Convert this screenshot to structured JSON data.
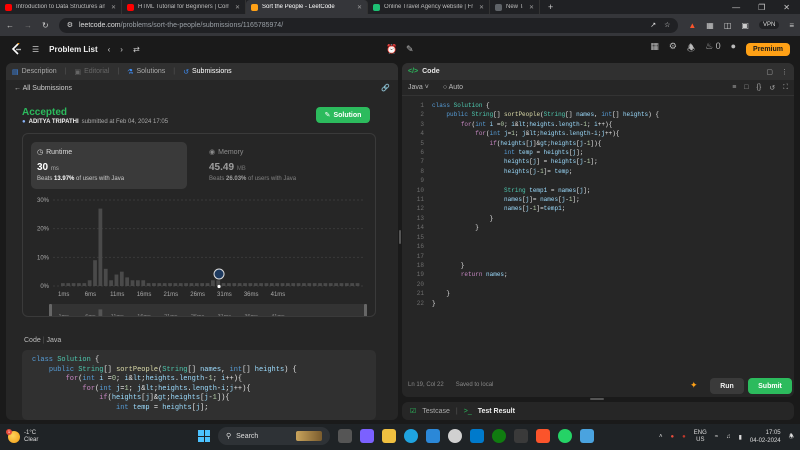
{
  "browser": {
    "tabs": [
      {
        "title": "Introduction to Data Structures and typ",
        "color": "#ff0000",
        "active": false
      },
      {
        "title": "HTML Tutorial for Beginners | Comple",
        "color": "#ff0000",
        "active": false
      },
      {
        "title": "Sort the People - LeetCode",
        "color": "#ffa116",
        "active": true
      },
      {
        "title": "Online Travel Agency website | Freela",
        "color": "#1dbf73",
        "active": false
      },
      {
        "title": "New Tab",
        "color": "#5f6368",
        "active": false
      }
    ],
    "new_tab": "+",
    "url_domain": "leetcode.com",
    "url_path": "/problems/sort-the-people/submissions/1165785974/",
    "vpn": "VPN",
    "window_controls": [
      "—",
      "❐",
      "✕"
    ]
  },
  "header": {
    "problem_list": "Problem List",
    "premium": "Premium",
    "streak": "0"
  },
  "left_tabs": [
    {
      "label": "Description",
      "icon": "description-icon",
      "active": false
    },
    {
      "label": "Editorial",
      "icon": "editorial-icon",
      "active": false
    },
    {
      "label": "Solutions",
      "icon": "flask-icon",
      "active": false
    },
    {
      "label": "Submissions",
      "icon": "history-icon",
      "active": true
    }
  ],
  "submission": {
    "back_label": "All Submissions",
    "status": "Accepted",
    "user": "ADITYA TRIPATHI",
    "submitted_text": "submitted at Feb 04, 2024 17:05",
    "solution_btn": "Solution",
    "runtime": {
      "label": "Runtime",
      "value": "30",
      "unit": "ms",
      "beats_pre": "Beats",
      "beats": "13.97%",
      "beats_post": "of users with Java"
    },
    "memory": {
      "label": "Memory",
      "value": "45.49",
      "unit": "MB",
      "beats_pre": "Beats",
      "beats": "26.03%",
      "beats_post": "of users with Java"
    },
    "code_label": "Code",
    "code_lang": "Java"
  },
  "chart_data": {
    "type": "bar",
    "yticks": [
      "30%",
      "20%",
      "10%",
      "0%"
    ],
    "ylim": [
      0,
      30
    ],
    "xticks": [
      "1ms",
      "6ms",
      "11ms",
      "16ms",
      "21ms",
      "26ms",
      "31ms",
      "36ms",
      "41ms"
    ],
    "values": [
      1,
      1,
      1,
      1,
      1,
      2,
      9,
      27,
      6,
      2,
      4,
      5,
      3,
      2,
      2,
      2,
      1,
      1,
      1,
      1,
      1,
      1,
      1,
      1,
      1,
      1,
      1,
      1,
      2,
      2,
      1,
      1,
      1,
      1,
      1,
      1,
      1,
      1,
      1,
      1,
      1,
      1,
      1,
      1,
      1,
      1,
      1,
      1,
      1,
      1,
      1,
      1,
      1,
      1,
      1,
      1
    ],
    "highlight_index": 29,
    "minimap_xticks": [
      "1ms",
      "6ms",
      "11ms",
      "16ms",
      "21ms",
      "26ms",
      "31ms",
      "36ms",
      "41ms"
    ]
  },
  "left_code": [
    "class Solution {",
    "    public String[] sortPeople(String[] names, int[] heights) {",
    "        for(int i =0; i<heights.length-1; i++){",
    "            for(int j=1; j<heights.length-i;j++){",
    "                if(heights[j]>heights[j-1]){",
    "                    int temp = heights[j];"
  ],
  "editor": {
    "title": "Code",
    "language": "Java",
    "mode": "Auto",
    "lines": [
      "class Solution {",
      "    public String[] sortPeople(String[] names, int[] heights) {",
      "        for(int i =0; i<heights.length-1; i++){",
      "            for(int j=1; j<heights.length-i;j++){",
      "                if(heights[j]>heights[j-1]){",
      "                    int temp = heights[j];",
      "                    heights[j] = heights[j-1];",
      "                    heights[j-1]= temp;",
      "",
      "                    String temp1 = names[j];",
      "                    names[j]= names[j-1];",
      "                    names[j-1]=temp1;",
      "                }",
      "            }",
      "",
      "",
      "",
      "        }",
      "        return names;",
      "",
      "    }",
      "}"
    ],
    "status_pos": "Ln 19, Col 22",
    "status_saved": "Saved to local",
    "run": "Run",
    "submit": "Submit"
  },
  "testbar": {
    "testcase": "Testcase",
    "result": "Test Result"
  },
  "taskbar": {
    "temp": "-1°C",
    "condition": "Clear",
    "search": "Search",
    "lang1": "ENG",
    "lang2": "US",
    "time": "17:05",
    "date": "04-02-2024"
  }
}
